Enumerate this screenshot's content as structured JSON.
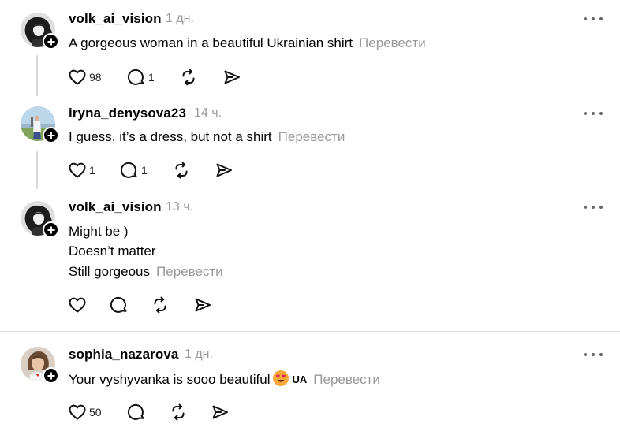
{
  "posts": [
    {
      "username": "volk_ai_vision",
      "time": "1 дн.",
      "lines": [
        "A gorgeous woman in a beautiful Ukrainian shirt"
      ],
      "translate": "Перевести",
      "likes": "98",
      "replies": "1"
    },
    {
      "username": "iryna_denysova23",
      "time": "14 ч.",
      "lines": [
        "I guess, it’s a dress, but not a shirt"
      ],
      "translate": "Перевести",
      "likes": "1",
      "replies": "1"
    },
    {
      "username": "volk_ai_vision",
      "time": "13 ч.",
      "lines": [
        "Might be )",
        "Doesn’t matter",
        "Still gorgeous"
      ],
      "translate": "Перевести",
      "likes": "",
      "replies": ""
    },
    {
      "username": "sophia_nazarova",
      "time": "1 дн.",
      "lines": [
        "Your vyshyvanka is sooo beautiful"
      ],
      "emoji": "heart-eyes-emoji",
      "flag": "UA",
      "translate": "Перевести",
      "likes": "50",
      "replies": ""
    }
  ],
  "icons": {
    "like": "heart-icon",
    "reply": "comment-icon",
    "repost": "repost-icon",
    "share": "send-icon",
    "more": "more-icon",
    "follow": "plus-icon"
  },
  "colors": {
    "muted": "#999999",
    "thread_line": "#d8d8d8",
    "text": "#000000"
  }
}
